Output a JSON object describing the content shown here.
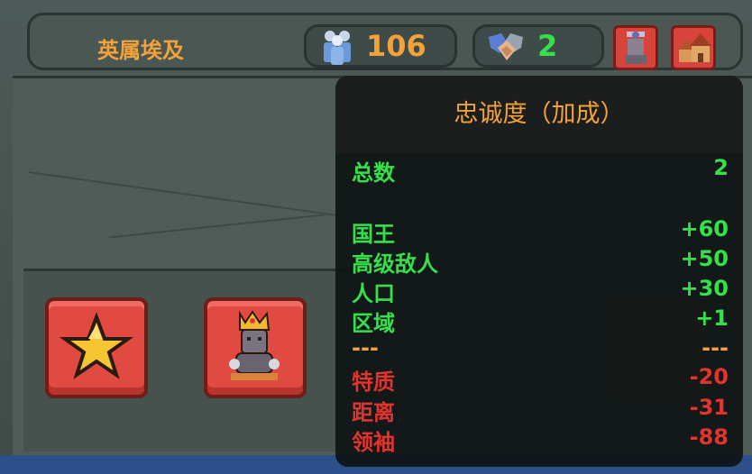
{
  "topbar": {
    "country_name": "英属埃及",
    "population": "106",
    "loyalty": "2"
  },
  "icons": {
    "population": "people-icon",
    "loyalty": "handshake-icon",
    "king": "king-portrait-icon",
    "city": "city-icon",
    "favorite": "star-icon",
    "ruler": "crowned-ruler-icon"
  },
  "tooltip": {
    "title": "忠诚度（加成）",
    "total": {
      "label": "总数",
      "value": "2"
    },
    "bonuses": [
      {
        "label": "国王",
        "value": "+60"
      },
      {
        "label": "高级敌人",
        "value": "+50"
      },
      {
        "label": "人口",
        "value": "+30"
      },
      {
        "label": "区域",
        "value": "+1"
      }
    ],
    "separator": {
      "label": "---",
      "value": "---"
    },
    "penalties": [
      {
        "label": "特质",
        "value": "-20"
      },
      {
        "label": "距离",
        "value": "-31"
      },
      {
        "label": "领袖",
        "value": "-88"
      }
    ]
  },
  "colors": {
    "orange": "#f2a23a",
    "green": "#35e04a",
    "red": "#e0342e",
    "button_red": "#e04a40"
  }
}
